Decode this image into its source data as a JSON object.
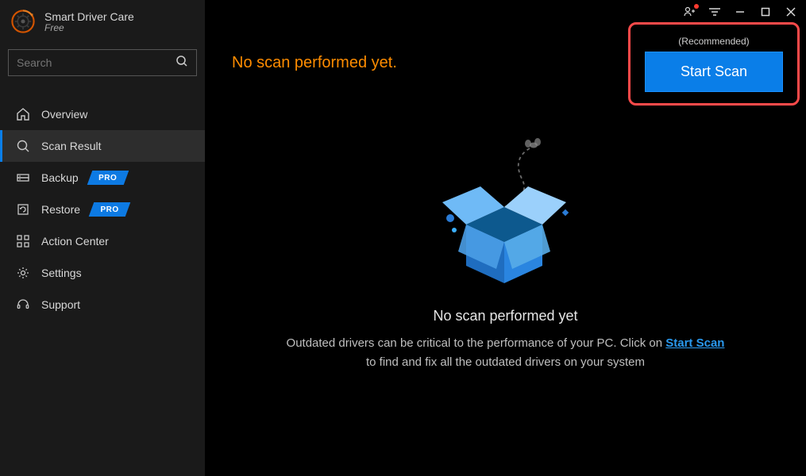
{
  "brand": {
    "title": "Smart Driver Care",
    "subtitle": "Free"
  },
  "search": {
    "placeholder": "Search"
  },
  "nav": {
    "overview": "Overview",
    "scan_result": "Scan Result",
    "backup": "Backup",
    "restore": "Restore",
    "action_center": "Action Center",
    "settings": "Settings",
    "support": "Support",
    "pro_label": "PRO"
  },
  "main": {
    "status": "No scan performed yet.",
    "recommended": "(Recommended)",
    "start_scan": "Start Scan",
    "center_title": "No scan performed yet",
    "desc_prefix": "Outdated drivers can be critical to the performance of your PC. Click on ",
    "desc_link": "Start Scan",
    "desc_suffix": "to find and fix all the outdated drivers on your system"
  }
}
